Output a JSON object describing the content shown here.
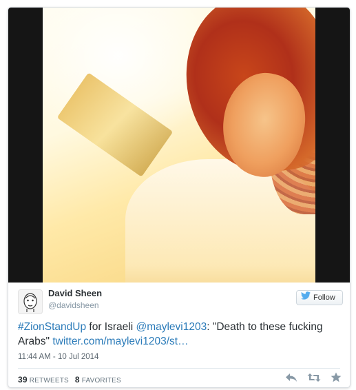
{
  "author": {
    "name": "David Sheen",
    "handle": "@davidsheen"
  },
  "follow_button": {
    "label": "Follow"
  },
  "tweet": {
    "hashtag": "#ZionStandUp",
    "text1": " for Israeli ",
    "mention": "@maylevi1203",
    "text2": ": \"Death to these fucking Arabs\" ",
    "link": "twitter.com/maylevi1203/st…"
  },
  "timestamp": "11:44 AM - 10 Jul 2014",
  "stats": {
    "retweets_count": "39",
    "retweets_label": "RETWEETS",
    "favorites_count": "8",
    "favorites_label": "FAVORITES"
  },
  "icons": {
    "follow": "twitter-bird-icon",
    "reply": "reply-icon",
    "retweet": "retweet-icon",
    "favorite": "star-icon"
  },
  "colors": {
    "link": "#2b7bb9",
    "twitter_blue": "#55acee",
    "text": "#292f33",
    "muted": "#8899a6"
  }
}
